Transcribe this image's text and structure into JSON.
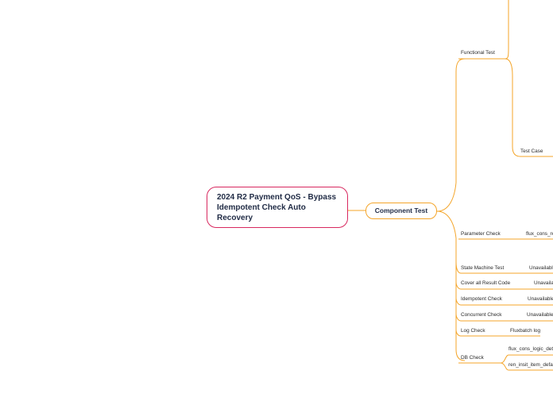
{
  "root": {
    "title": "2024 R2 Payment QoS - Bypass Idempotent Check Auto Recovery"
  },
  "central": {
    "label": "Component Test"
  },
  "branches": [
    {
      "label": "Functional Test"
    },
    {
      "label": "Test Case"
    },
    {
      "label": "Parameter Check",
      "child": "flux_cons_re"
    },
    {
      "label": "State Machine Test",
      "child": "Unavailabl"
    },
    {
      "label": "Cover all Result Code",
      "child": "Unavaila"
    },
    {
      "label": "Idempotent Check",
      "child": "Unavailable"
    },
    {
      "label": "Concurrent Check",
      "child": "Unavailable"
    },
    {
      "label": "Log Check",
      "child": "Fluxbatch log"
    },
    {
      "label": "DB Check",
      "children": [
        "flux_cons_logic_deta",
        "ren_insit_item_defau"
      ]
    }
  ],
  "colors": {
    "root_border": "#d8285f",
    "branch_line": "#f4a52a"
  }
}
